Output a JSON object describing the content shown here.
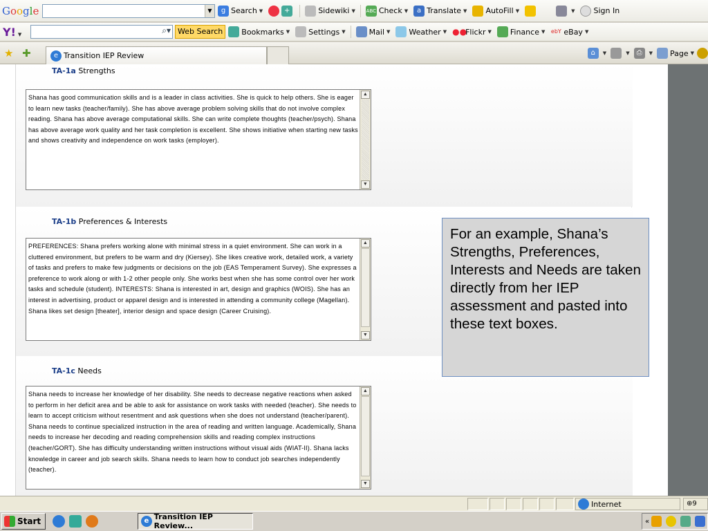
{
  "google_toolbar": {
    "logo": "Google",
    "items": [
      "Search",
      "Sidewiki",
      "Check",
      "Translate",
      "AutoFill",
      "Sign In"
    ]
  },
  "yahoo_toolbar": {
    "logo": "Y!",
    "search_button": "Web Search",
    "items": [
      "Bookmarks",
      "Settings",
      "Mail",
      "Weather",
      "Flickr",
      "Finance",
      "eBay"
    ]
  },
  "tabs": {
    "active_title": "Transition IEP Review",
    "page_menu": "Page"
  },
  "sections": [
    {
      "code": "TA-1a",
      "label": "Strengths",
      "text": "Shana has good communication skills and is a leader in class activities. She is quick to help others. She is eager to learn new tasks (teacher/family). She has above average problem solving skills that do not involve complex reading. Shana has above average computational skills. She can write complete thoughts (teacher/psych). Shana has above average work quality and her task completion is excellent. She shows initiative when starting new tasks and shows creativity and independence on work tasks (employer)."
    },
    {
      "code": "TA-1b",
      "label": "Preferences & Interests",
      "text": "PREFERENCES: Shana prefers working alone with minimal stress in a quiet environment. She can work in a cluttered environment, but prefers to be warm and dry (Kiersey). She likes creative work, detailed work, a variety of tasks and prefers to make few judgments or decisions on the job (EAS Temperament Survey). She expresses a preference to work along or with 1-2 other people only. She works best when she has some control over her work tasks and schedule (student). INTERESTS: Shana is interested in art, design and graphics (WOIS). She has an interest in advertising, product or apparel design and is interested in attending a community college (Magellan). Shana likes set design [theater], interior design and space design (Career Cruising)."
    },
    {
      "code": "TA-1c",
      "label": "Needs",
      "text": "Shana needs to increase her knowledge of her disability. She needs to decrease negative reactions when asked to perform in her deficit area and be able to ask for assistance on work tasks with needed (teacher). She needs to learn to accept criticism without resentment and ask questions when she does not understand (teacher/parent). Shana needs to continue specialized instruction in the area of reading and written language. Academically, Shana needs to increase her decoding and reading comprehension skills and reading complex instructions (teacher/GORT). She has difficulty understanding written instructions without visual aids (WIAT-II). Shana lacks knowledge in career and job search skills. Shana needs to learn how to conduct job searches independently (teacher)."
    }
  ],
  "callout": "For an example, Shana’s Strengths, Preferences, Interests and Needs are taken directly from her IEP assessment and pasted into these text boxes.",
  "status_bar": {
    "zone": "Internet",
    "zoom": "9"
  },
  "taskbar": {
    "start": "Start",
    "task": "Transition IEP Review...",
    "tray": "«"
  }
}
